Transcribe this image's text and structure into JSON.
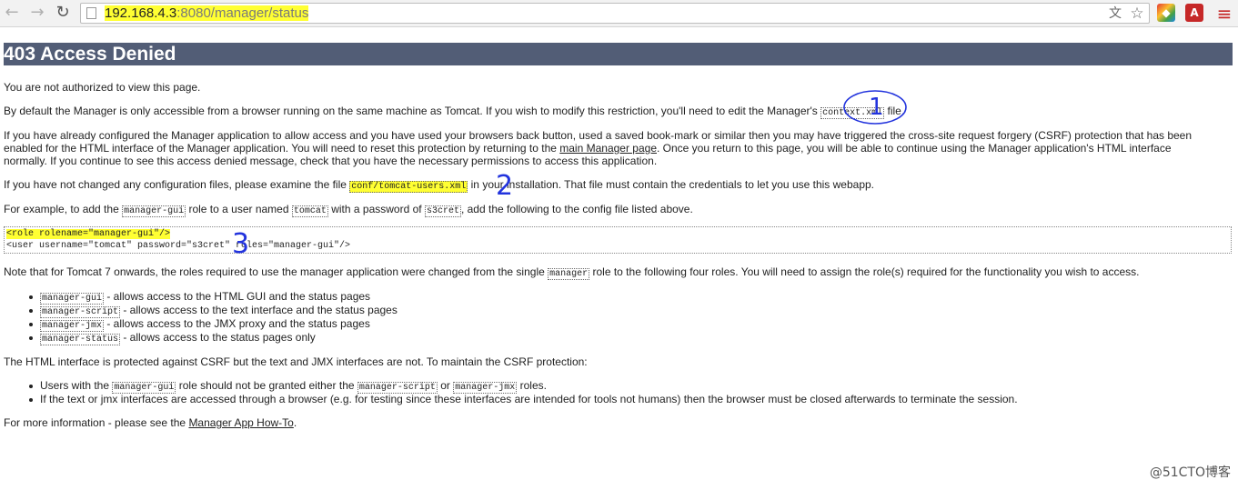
{
  "browser": {
    "back_icon": "←",
    "forward_icon": "→",
    "reload_icon": "↻",
    "url_host": "192.168.4.3",
    "url_rest": ":8080/manager/status",
    "translate_icon": "文",
    "star_icon": "☆",
    "ext1_icon": "◆",
    "ext2_icon": "A",
    "menu_icon": "≡",
    "highlight_color": "#ffff33"
  },
  "page": {
    "title": "403 Access Denied",
    "p1": "You are not authorized to view this page.",
    "p2_before": "By default the Manager is only accessible from a browser running on the same machine as Tomcat. If you wish to modify this restriction, you'll need to edit the Manager's",
    "p2_code": "context.xml",
    "p2_after": "file.",
    "p3_line1": "If you have already configured the Manager application to allow access and you have used your browsers back button, used a saved book-mark or similar then you may have triggered the cross-site request forgery (CSRF) protection that has been",
    "p3_line2_before": "enabled for the HTML interface of the Manager application. You will need to reset this protection by returning to the",
    "p3_link": "main Manager page",
    "p3_line2_after": ". Once you return to this page, you will be able to continue using the Manager application's HTML interface",
    "p3_line3": "normally. If you continue to see this access denied message, check that you have the necessary permissions to access this application.",
    "p4_before": "If you have not changed any configuration files, please examine the file",
    "p4_code": "conf/tomcat-users.xml",
    "p4_after": "in your installation. That file must contain the credentials to let you use this webapp.",
    "p5_a": "For example, to add the",
    "p5_code1": "manager-gui",
    "p5_b": "role to a user named",
    "p5_code2": "tomcat",
    "p5_c": "with a password of",
    "p5_code3": "s3cret",
    "p5_d": ", add the following to the config file listed above.",
    "pre_line1": "<role rolename=\"manager-gui\"/>",
    "pre_line2": "<user username=\"tomcat\" password=\"s3cret\" roles=\"manager-gui\"/>",
    "p6_before": "Note that for Tomcat 7 onwards, the roles required to use the manager application were changed from the single",
    "p6_code": "manager",
    "p6_after": "role to the following four roles. You will need to assign the role(s) required for the functionality you wish to access.",
    "roles": [
      {
        "code": "manager-gui",
        "text": " - allows access to the HTML GUI and the status pages"
      },
      {
        "code": "manager-script",
        "text": " - allows access to the text interface and the status pages"
      },
      {
        "code": "manager-jmx",
        "text": " - allows access to the JMX proxy and the status pages"
      },
      {
        "code": "manager-status",
        "text": " - allows access to the status pages only"
      }
    ],
    "p7": "The HTML interface is protected against CSRF but the text and JMX interfaces are not. To maintain the CSRF protection:",
    "csrf_1_a": "Users with the",
    "csrf_1_code1": "manager-gui",
    "csrf_1_b": "role should not be granted either the",
    "csrf_1_code2": "manager-script",
    "csrf_1_c": "or",
    "csrf_1_code3": "manager-jmx",
    "csrf_1_d": "roles.",
    "csrf_2": "If the text or jmx interfaces are accessed through a browser (e.g. for testing since these interfaces are intended for tools not humans) then the browser must be closed afterwards to terminate the session.",
    "p8_before": "For more information - please see the",
    "p8_link": "Manager App How-To",
    "p8_after": "."
  },
  "annotations": {
    "mark1": "1",
    "mark2": "2",
    "mark3": "3",
    "ink_color": "#2233dd"
  },
  "watermark": "@51CTO博客"
}
